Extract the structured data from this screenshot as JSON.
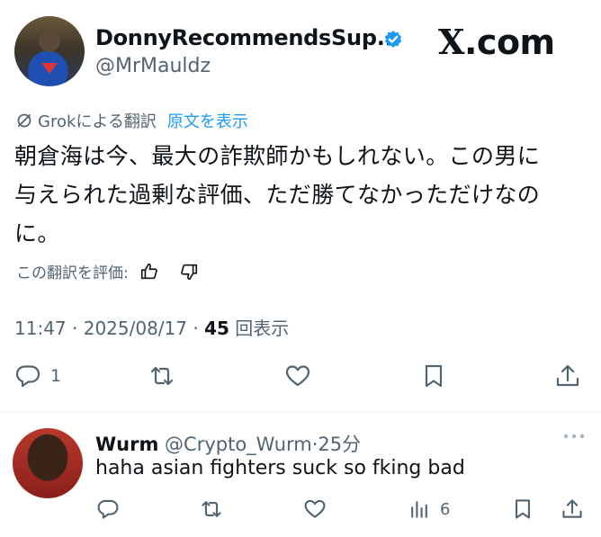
{
  "main_tweet": {
    "display_name": "DonnyRecommendsSup...",
    "handle": "@MrMauldz",
    "brand": {
      "x": "X",
      "suffix": ".com"
    },
    "translation": {
      "label": "Grokによる翻訳",
      "show_original": "原文を表示"
    },
    "text_lines": [
      "朝倉海は今、最大の詐欺師かもしれない。この男に",
      "与えられた過剰な評価、ただ勝てなかっただけなの",
      "に。"
    ],
    "rate_label": "この翻訳を評価:",
    "time": "11:47",
    "date": "2025/08/17",
    "views_count": "45",
    "views_label": "回表示",
    "reply_count": "1"
  },
  "reply_tweet": {
    "display_name": "Wurm",
    "handle": "@Crypto_Wurm",
    "age": "25分",
    "text": "haha asian fighters suck so fking bad",
    "views_count": "6"
  },
  "colors": {
    "text": "#0f1419",
    "muted": "#536471",
    "link": "#1d9bf0",
    "verified": "#1d9bf0",
    "divider": "#eff3f4"
  }
}
